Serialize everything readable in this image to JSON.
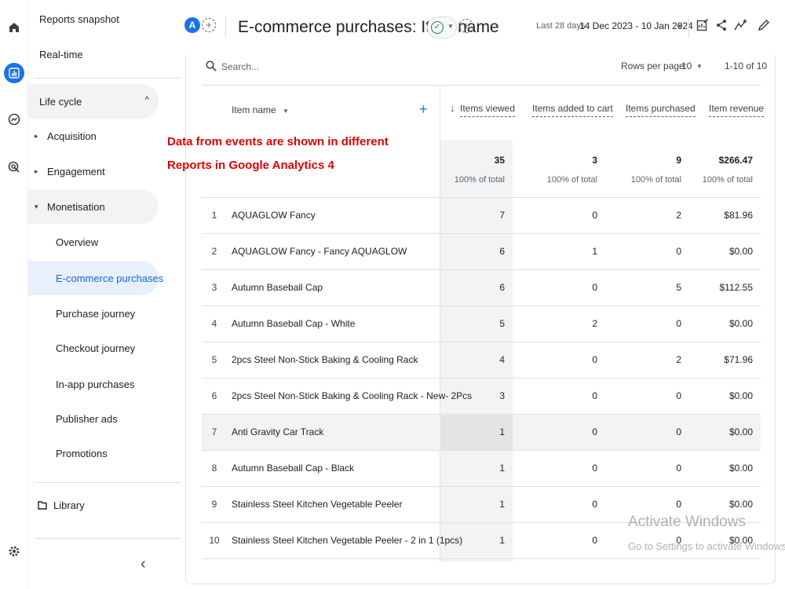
{
  "sidebar": {
    "reports_snapshot": "Reports snapshot",
    "realtime": "Real-time",
    "lifecycle": {
      "label": "Life cycle",
      "collapse_icon": "chevron-up-icon"
    },
    "groups": [
      {
        "label": "Acquisition"
      },
      {
        "label": "Engagement"
      },
      {
        "label": "Monetisation"
      }
    ],
    "monetisation_items": [
      {
        "label": "Overview"
      },
      {
        "label": "E-commerce purchases"
      },
      {
        "label": "Purchase journey"
      },
      {
        "label": "Checkout journey"
      },
      {
        "label": "In-app purchases"
      },
      {
        "label": "Publisher ads"
      },
      {
        "label": "Promotions"
      }
    ],
    "library": "Library",
    "collapse_glyph": "‹"
  },
  "header": {
    "avatar_letter": "A",
    "title": "E-commerce purchases: Item name",
    "date_label": "Last 28 days",
    "date_range": "14 Dec 2023 - 10 Jan 2024"
  },
  "table_controls": {
    "search_placeholder": "Search...",
    "rows_per_page_label": "Rows per page:",
    "rows_per_page": "10",
    "range": "1-10 of 10"
  },
  "table": {
    "dimension_header": "Item name",
    "add_dimension": "+",
    "sort_indicator": "↓",
    "metric_headers": [
      "Items viewed",
      "Items added to cart",
      "Items purchased",
      "Item revenue"
    ],
    "totals": {
      "values": [
        "35",
        "3",
        "9",
        "$266.47"
      ],
      "pct": [
        "100% of total",
        "100% of total",
        "100% of total",
        "100% of total"
      ]
    },
    "rows": [
      {
        "idx": "1",
        "name": "AQUAGLOW Fancy",
        "viewed": "7",
        "added": "0",
        "purchased": "2",
        "revenue": "$81.96"
      },
      {
        "idx": "2",
        "name": "AQUAGLOW Fancy - Fancy AQUAGLOW",
        "viewed": "6",
        "added": "1",
        "purchased": "0",
        "revenue": "$0.00"
      },
      {
        "idx": "3",
        "name": "Autumn Baseball Cap",
        "viewed": "6",
        "added": "0",
        "purchased": "5",
        "revenue": "$112.55"
      },
      {
        "idx": "4",
        "name": "Autumn Baseball Cap - White",
        "viewed": "5",
        "added": "2",
        "purchased": "0",
        "revenue": "$0.00"
      },
      {
        "idx": "5",
        "name": "2pcs Steel Non-Stick Baking & Cooling Rack",
        "viewed": "4",
        "added": "0",
        "purchased": "2",
        "revenue": "$71.96"
      },
      {
        "idx": "6",
        "name": "2pcs Steel Non-Stick Baking & Cooling Rack - New- 2Pcs",
        "viewed": "3",
        "added": "0",
        "purchased": "0",
        "revenue": "$0.00"
      },
      {
        "idx": "7",
        "name": "Anti Gravity Car Track",
        "viewed": "1",
        "added": "0",
        "purchased": "0",
        "revenue": "$0.00"
      },
      {
        "idx": "8",
        "name": "Autumn Baseball Cap - Black",
        "viewed": "1",
        "added": "0",
        "purchased": "0",
        "revenue": "$0.00"
      },
      {
        "idx": "9",
        "name": "Stainless Steel Kitchen Vegetable Peeler",
        "viewed": "1",
        "added": "0",
        "purchased": "0",
        "revenue": "$0.00"
      },
      {
        "idx": "10",
        "name": "Stainless Steel Kitchen Vegetable Peeler - 2 in 1 (1pcs)",
        "viewed": "1",
        "added": "0",
        "purchased": "0",
        "revenue": "$0.00"
      }
    ]
  },
  "annotation": {
    "line1": "Data from events are shown in different",
    "line2": "Reports in Google Analytics 4"
  },
  "watermark": {
    "line1": "Activate Windows",
    "line2": "Go to Settings to activate Windows."
  },
  "colors": {
    "accent": "#1a73e8",
    "selected_bg": "#e8f0fe",
    "annotation": "#e00000",
    "check": "#188038"
  },
  "icons": {
    "rail": [
      "home-icon",
      "reports-icon",
      "explore-icon",
      "advertising-icon",
      "settings-icon"
    ],
    "header": [
      "customize-report-icon",
      "share-icon",
      "insights-icon",
      "edit-icon"
    ]
  }
}
